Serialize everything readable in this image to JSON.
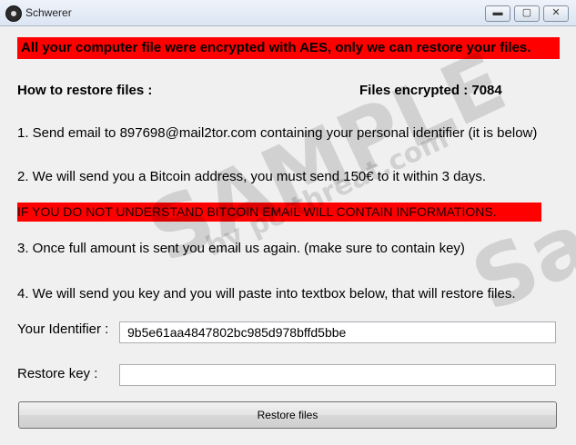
{
  "window": {
    "title": "Schwerer",
    "min_glyph": "▬",
    "max_glyph": "▢",
    "close_glyph": "✕"
  },
  "banner_top": "All your computer file were encrypted with AES, only we can restore your files.",
  "how_to": "How to restore files :",
  "files_encrypted": "Files encrypted : 7084",
  "steps": {
    "s1": "1. Send email to 897698@mail2tor.com containing your personal identifier (it is below)",
    "s2": "2. We will send you a Bitcoin address, you must send 150€ to it within 3 days.",
    "s3": "3. Once full amount is sent you email us again. (make sure to contain key)",
    "s4": "4. We will send you key and you will paste into textbox below, that will restore files."
  },
  "banner_mid": "IF YOU DO NOT UNDERSTAND BITCOIN EMAIL WILL CONTAIN INFORMATIONS.",
  "identifier": {
    "label": "Your Identifier :",
    "value": "9b5e61aa4847802bc985d978bffd5bbe"
  },
  "restore_key": {
    "label": "Restore key :",
    "value": ""
  },
  "restore_button": "Restore files",
  "watermark": {
    "big1": "SAMPLE",
    "small": "by pc-threat.com",
    "big2": "Sa"
  },
  "colors": {
    "banner": "#ff0000"
  }
}
